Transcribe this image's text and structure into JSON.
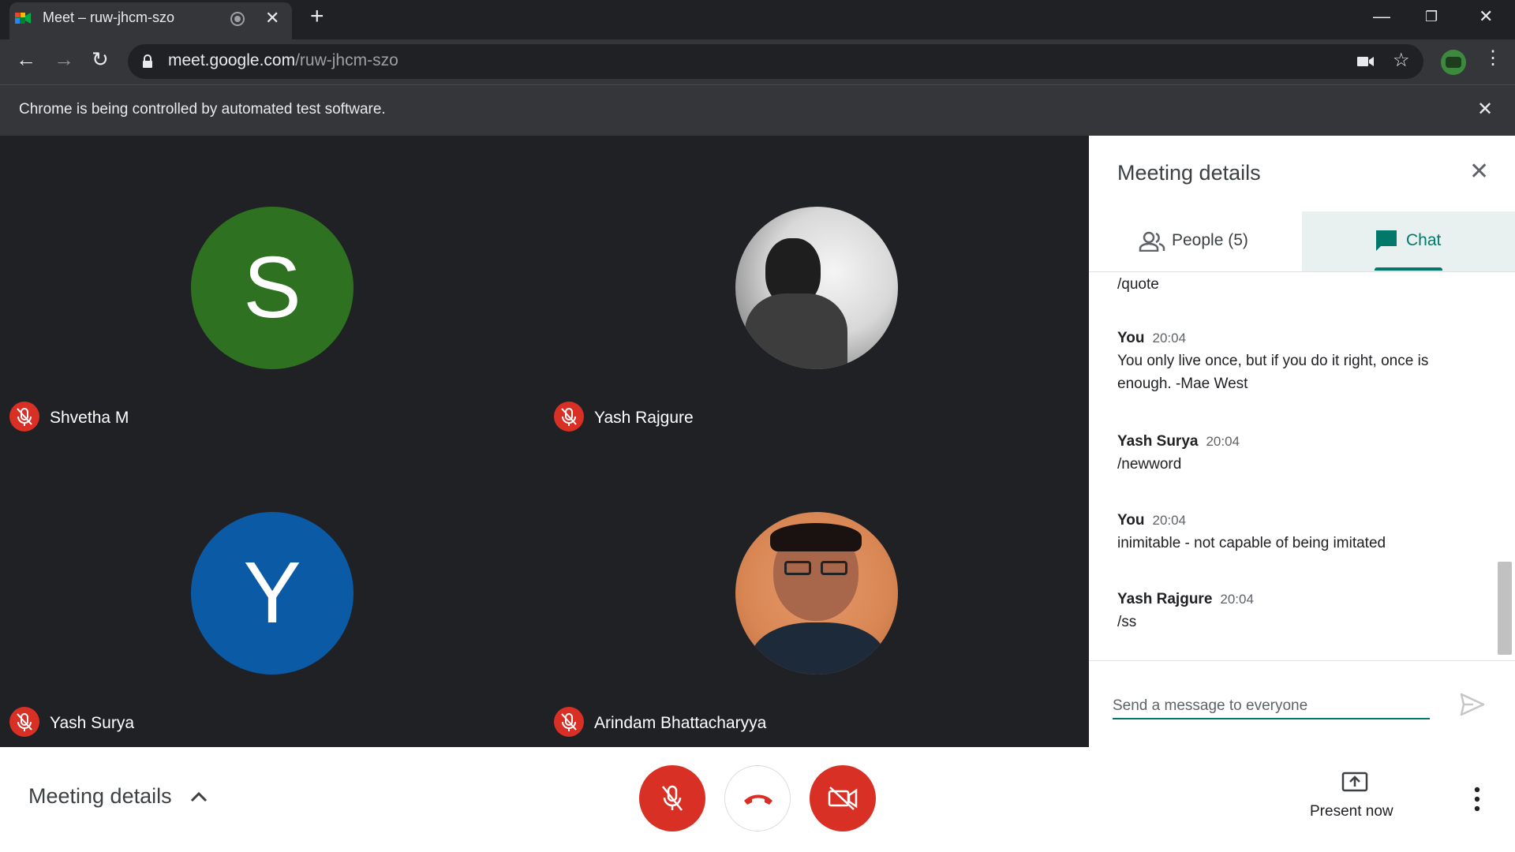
{
  "browser": {
    "tab_title": "Meet – ruw-jhcm-szo",
    "url_domain": "meet.google.com",
    "url_path": "/ruw-jhcm-szo",
    "infobar_text": "Chrome is being controlled by automated test software."
  },
  "participants": [
    {
      "name": "Shvetha M",
      "initial": "S",
      "color": "#2e7121"
    },
    {
      "name": "Yash Rajgure",
      "initial": "",
      "color": ""
    },
    {
      "name": "Yash Surya",
      "initial": "Y",
      "color": "#0b5aa6"
    },
    {
      "name": "Arindam Bhattacharyya",
      "initial": "",
      "color": ""
    }
  ],
  "panel": {
    "title": "Meeting details",
    "people_tab": "People (5)",
    "chat_tab": "Chat",
    "partial_message": "/quote",
    "messages": [
      {
        "sender": "You",
        "time": "20:04",
        "text": "You only live once, but if you do it right, once is enough. -Mae West"
      },
      {
        "sender": "Yash Surya",
        "time": "20:04",
        "text": "/newword"
      },
      {
        "sender": "You",
        "time": "20:04",
        "text": "inimitable - not capable of being imitated"
      },
      {
        "sender": "Yash Rajgure",
        "time": "20:04",
        "text": "/ss"
      }
    ],
    "compose_placeholder": "Send a message to everyone"
  },
  "bottom": {
    "meeting_details": "Meeting details",
    "present_now": "Present now"
  },
  "colors": {
    "accent": "#00796b",
    "danger": "#d93025"
  }
}
